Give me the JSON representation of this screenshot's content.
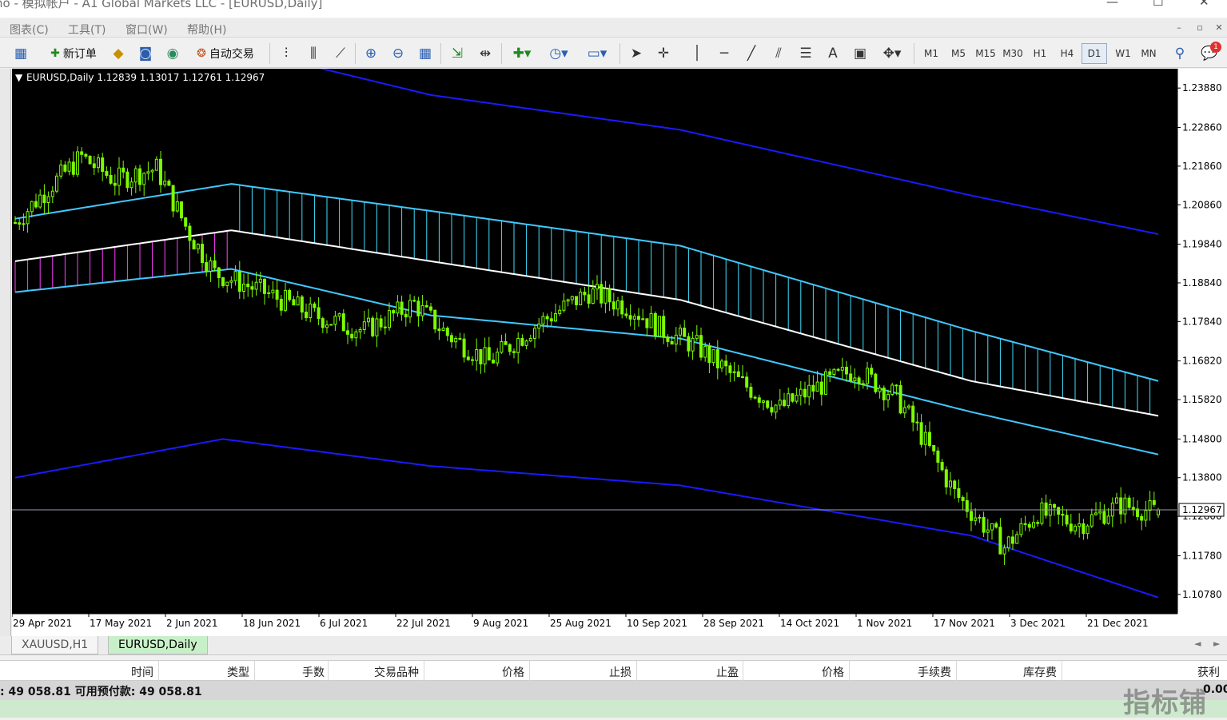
{
  "window": {
    "title": "no - 模拟帐户 - A1 Global Markets LLC - [EURUSD,Daily]",
    "controls": [
      "—",
      "☐",
      "✕"
    ]
  },
  "menu": {
    "items": [
      "图表(C)",
      "工具(T)",
      "窗口(W)",
      "帮助(H)"
    ],
    "mdi_controls": [
      "–",
      "▫",
      "✕"
    ]
  },
  "toolbar": {
    "new_order_label": "新订单",
    "auto_trade_label": "自动交易",
    "timeframes": [
      "M1",
      "M5",
      "M15",
      "M30",
      "H1",
      "H4",
      "D1",
      "W1",
      "MN"
    ],
    "active_timeframe": "D1",
    "alert_count": "1"
  },
  "chart": {
    "header": "EURUSD,Daily  1.12839 1.13017 1.12761 1.12967",
    "current_price_label": "1.12967",
    "colors": {
      "background": "#000000",
      "candle": "#7cfc00",
      "envelope_outer": "#1a1aff",
      "envelope_inner": "#40c8ff",
      "ma_white": "#ffffff",
      "cloud_bearish": "#40e0ff",
      "cloud_bullish": "#ff40ff"
    }
  },
  "chart_data": {
    "type": "candlestick",
    "symbol": "EURUSD",
    "timeframe": "Daily",
    "ohlc_last": {
      "open": 1.12839,
      "high": 1.13017,
      "low": 1.12761,
      "close": 1.12967
    },
    "ylim": [
      1.1028,
      1.2438
    ],
    "y_ticks": [
      1.2388,
      1.2286,
      1.2186,
      1.2086,
      1.1984,
      1.1884,
      1.1784,
      1.1682,
      1.1582,
      1.148,
      1.138,
      1.128,
      1.1178,
      1.1078
    ],
    "x_tick_labels": [
      "29 Apr 2021",
      "17 May 2021",
      "2 Jun 2021",
      "18 Jun 2021",
      "6 Jul 2021",
      "22 Jul 2021",
      "9 Aug 2021",
      "25 Aug 2021",
      "10 Sep 2021",
      "28 Sep 2021",
      "14 Oct 2021",
      "1 Nov 2021",
      "17 Nov 2021",
      "3 Dec 2021",
      "21 Dec 2021"
    ],
    "close_path": [
      [
        0,
        1.204
      ],
      [
        8,
        1.213
      ],
      [
        16,
        1.221
      ],
      [
        24,
        1.215
      ],
      [
        34,
        1.218
      ],
      [
        42,
        1.201
      ],
      [
        48,
        1.191
      ],
      [
        60,
        1.186
      ],
      [
        72,
        1.18
      ],
      [
        84,
        1.176
      ],
      [
        96,
        1.183
      ],
      [
        104,
        1.175
      ],
      [
        114,
        1.168
      ],
      [
        126,
        1.178
      ],
      [
        138,
        1.186
      ],
      [
        148,
        1.182
      ],
      [
        156,
        1.176
      ],
      [
        164,
        1.172
      ],
      [
        174,
        1.163
      ],
      [
        184,
        1.156
      ],
      [
        192,
        1.161
      ],
      [
        202,
        1.166
      ],
      [
        212,
        1.159
      ],
      [
        218,
        1.149
      ],
      [
        226,
        1.134
      ],
      [
        232,
        1.127
      ],
      [
        238,
        1.12
      ],
      [
        246,
        1.129
      ],
      [
        256,
        1.126
      ],
      [
        266,
        1.131
      ],
      [
        275,
        1.129
      ]
    ],
    "envelope_upper": [
      [
        0,
        1.256
      ],
      [
        50,
        1.25
      ],
      [
        100,
        1.237
      ],
      [
        160,
        1.228
      ],
      [
        230,
        1.211
      ],
      [
        275,
        1.201
      ]
    ],
    "envelope_lower": [
      [
        0,
        1.138
      ],
      [
        50,
        1.148
      ],
      [
        100,
        1.141
      ],
      [
        160,
        1.136
      ],
      [
        230,
        1.123
      ],
      [
        275,
        1.107
      ]
    ],
    "inner_upper": [
      [
        0,
        1.205
      ],
      [
        52,
        1.214
      ],
      [
        100,
        1.207
      ],
      [
        160,
        1.198
      ],
      [
        230,
        1.176
      ],
      [
        275,
        1.163
      ]
    ],
    "inner_lower": [
      [
        0,
        1.186
      ],
      [
        52,
        1.192
      ],
      [
        100,
        1.18
      ],
      [
        160,
        1.174
      ],
      [
        230,
        1.155
      ],
      [
        275,
        1.144
      ]
    ],
    "ma_white": [
      [
        0,
        1.194
      ],
      [
        52,
        1.202
      ],
      [
        100,
        1.194
      ],
      [
        160,
        1.184
      ],
      [
        230,
        1.163
      ],
      [
        275,
        1.154
      ]
    ],
    "cloud_switch_index": 52
  },
  "tabs": {
    "items": [
      "XAUUSD,H1",
      "EURUSD,Daily"
    ],
    "active": "EURUSD,Daily",
    "arrows": [
      "◄",
      "►"
    ]
  },
  "terminal": {
    "columns": [
      "时间",
      "类型",
      "手数",
      "交易品种",
      "价格",
      "止损",
      "止盈",
      "价格",
      "手续费",
      "库存费",
      "获利"
    ],
    "balance_text": ": 49 058.81  可用预付款: 49 058.81",
    "profit_value": "0.00"
  },
  "watermark": "指标铺"
}
